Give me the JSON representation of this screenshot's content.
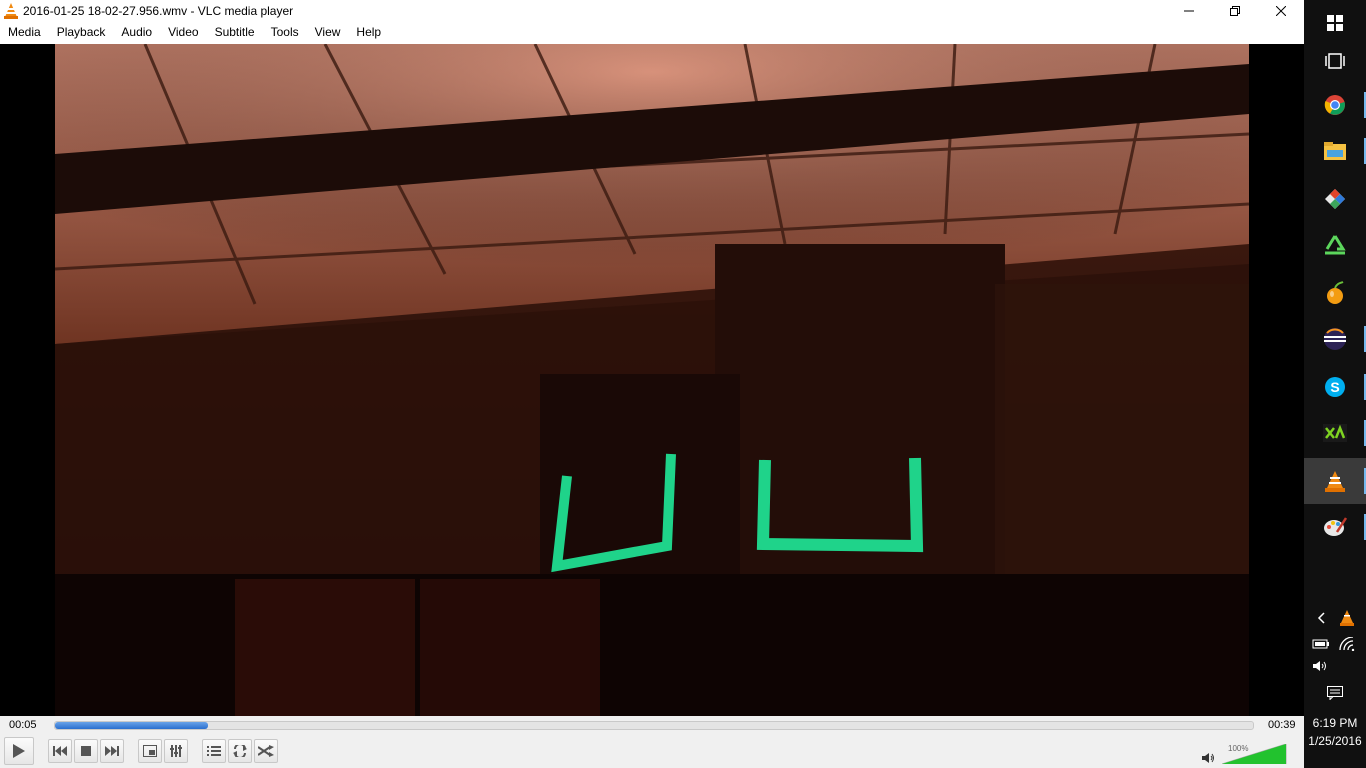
{
  "window": {
    "title": "2016-01-25 18-02-27.956.wmv - VLC media player"
  },
  "menu": [
    "Media",
    "Playback",
    "Audio",
    "Video",
    "Subtitle",
    "Tools",
    "View",
    "Help"
  ],
  "playback": {
    "elapsed": "00:05",
    "duration": "00:39",
    "progress": 0.128
  },
  "volume": {
    "label": "100%",
    "level": 1.0
  },
  "controls": {
    "icons": [
      "play-icon",
      "previous-icon",
      "stop-icon",
      "next-icon",
      "fullscreen-icon",
      "extended-settings-icon",
      "playlist-icon",
      "loop-icon",
      "shuffle-icon",
      "speaker-icon"
    ]
  },
  "colors": {
    "accent": "#2a6fcf",
    "tape_green": "#1fd38a",
    "taskbar": "#101010",
    "volume_green": "#22c22e"
  },
  "taskbar": {
    "apps": [
      "windows-start-icon",
      "task-view-icon",
      "chrome-icon",
      "file-explorer-icon",
      "git-icon",
      "recycle-app-icon",
      "fl-studio-icon",
      "eclipse-icon",
      "skype-icon",
      "xda-icon",
      "vlc-icon",
      "paint-icon"
    ],
    "active": "vlc-icon"
  },
  "clock": {
    "time": "6:19 PM",
    "date": "1/25/2016"
  }
}
